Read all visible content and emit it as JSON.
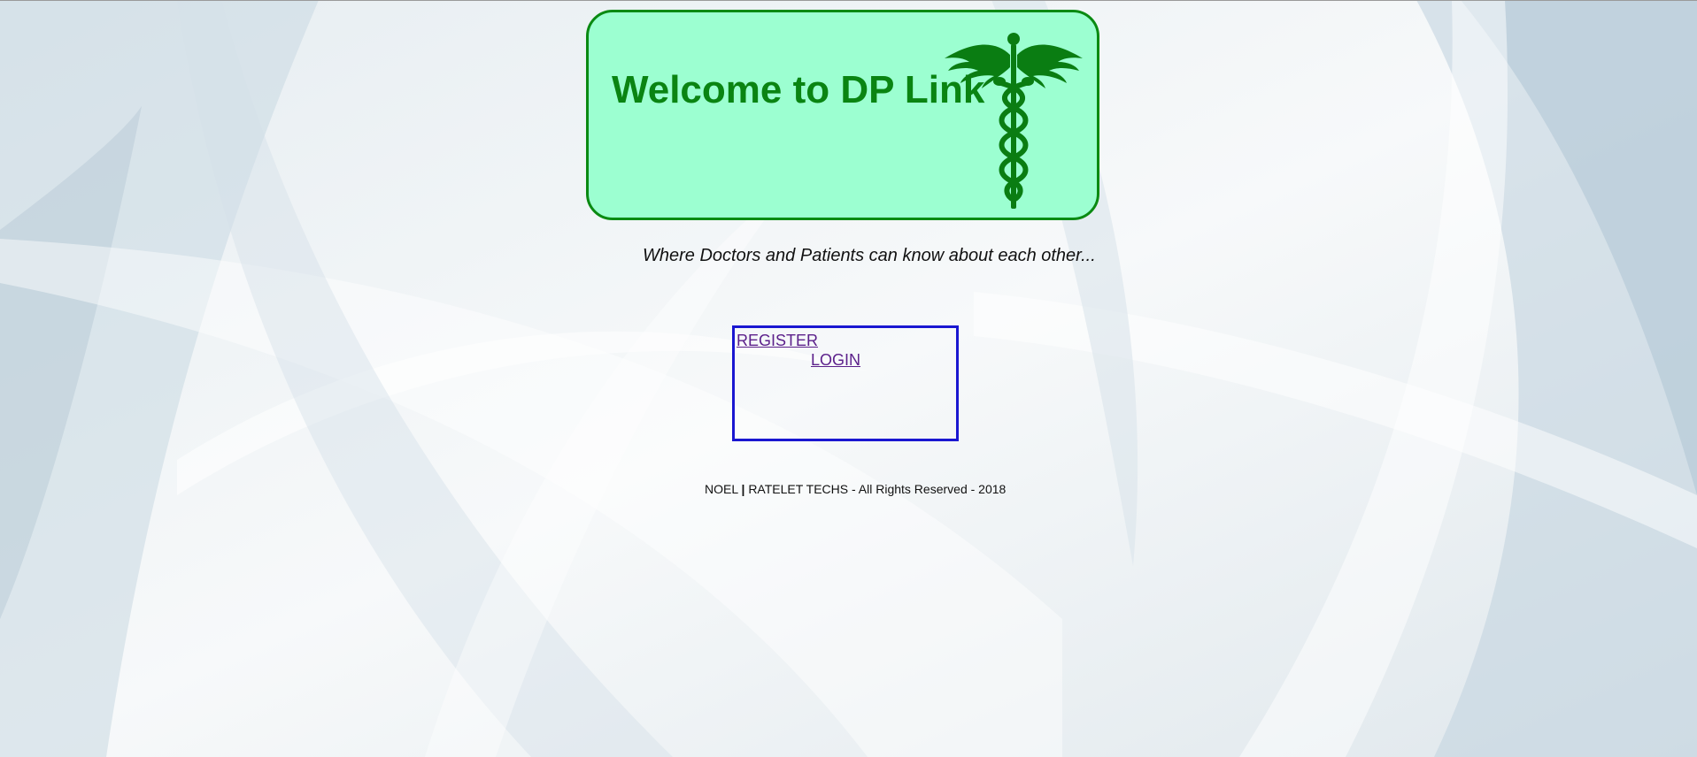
{
  "banner": {
    "title": "Welcome to DP Link",
    "logo_icon": "caduceus-icon",
    "background_color": "#9cffd1",
    "border_color": "#0a8a12",
    "title_color": "#0a8412"
  },
  "tagline": "Where Doctors and Patients can know about each other...",
  "nav": {
    "register_label": "REGISTER",
    "login_label": "LOGIN",
    "border_color": "#1a17d1",
    "link_color": "#5b1f8a"
  },
  "footer": {
    "owner": "NOEL",
    "separator": "|",
    "rights": "RATELET TECHS - All Rights Reserved - 2018"
  }
}
